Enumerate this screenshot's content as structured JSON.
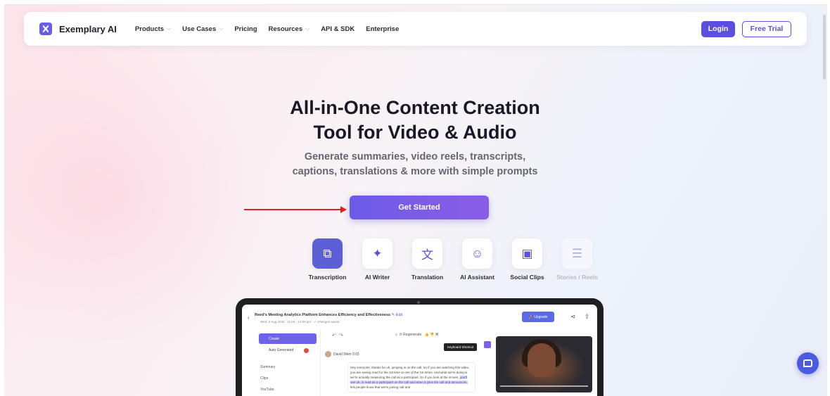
{
  "nav": {
    "brand": "Exemplary AI",
    "items": [
      {
        "label": "Products",
        "dropdown": true
      },
      {
        "label": "Use Cases",
        "dropdown": true
      },
      {
        "label": "Pricing",
        "dropdown": false
      },
      {
        "label": "Resources",
        "dropdown": true
      },
      {
        "label": "API & SDK",
        "dropdown": false
      },
      {
        "label": "Enterprise",
        "dropdown": false
      }
    ],
    "login": "Login",
    "free_trial": "Free Trial"
  },
  "hero": {
    "title_line1": "All-in-One Content Creation",
    "title_line2": "Tool for Video & Audio",
    "subtitle_line1": "Generate summaries, video reels, transcripts,",
    "subtitle_line2": "captions, translations & more with simple prompts",
    "cta": "Get Started"
  },
  "features": [
    {
      "label": "Transcription",
      "icon": "transcription-icon",
      "glyph": "⧉",
      "active": true
    },
    {
      "label": "AI Writer",
      "icon": "sparkle-icon",
      "glyph": "✦",
      "active": false
    },
    {
      "label": "Translation",
      "icon": "translate-icon",
      "glyph": "文",
      "active": false
    },
    {
      "label": "AI Assistant",
      "icon": "robot-icon",
      "glyph": "☺",
      "active": false
    },
    {
      "label": "Social Clips",
      "icon": "film-icon",
      "glyph": "▣",
      "active": false
    },
    {
      "label": "Stories / Reels",
      "icon": "stories-icon",
      "glyph": "☰",
      "active": false,
      "faded": true
    }
  ],
  "preview": {
    "title": "Reed's Meeting Analytics Platform Enhances Efficiency and Effectiveness",
    "edit": "Edit",
    "date": "Wed, 2 Aug 2023 · 11:04 - 12:00 am · ✓ Changes saved",
    "upgrade": "Upgrade",
    "create": "Create",
    "auto_generated": "Auto Generated",
    "sidebar_items": [
      "Summary",
      "Clips",
      "YouTube"
    ],
    "toolbar_tools": "Regenerate",
    "tooltip": "Keyboard Shortcut",
    "speaker": "David Shim 0:03",
    "transcript_plain": "Hey everyone, thanks for uh, jumping in on the call. So if you are watching this video, you are seeing read for the 1st time or one of the 1st times. And what we're doing is we're actually measuring the call as a participant. So if you look at the screen,",
    "transcript_highlight": "you'll see uh, is read as a participant on the call and when it joins the call and announces,",
    "transcript_tail": "lets people know that we're joining call and"
  },
  "colors": {
    "accent": "#5b4fe0",
    "cta_start": "#6c5be8",
    "cta_end": "#8a5ce6",
    "annotation_arrow": "#e02020"
  }
}
